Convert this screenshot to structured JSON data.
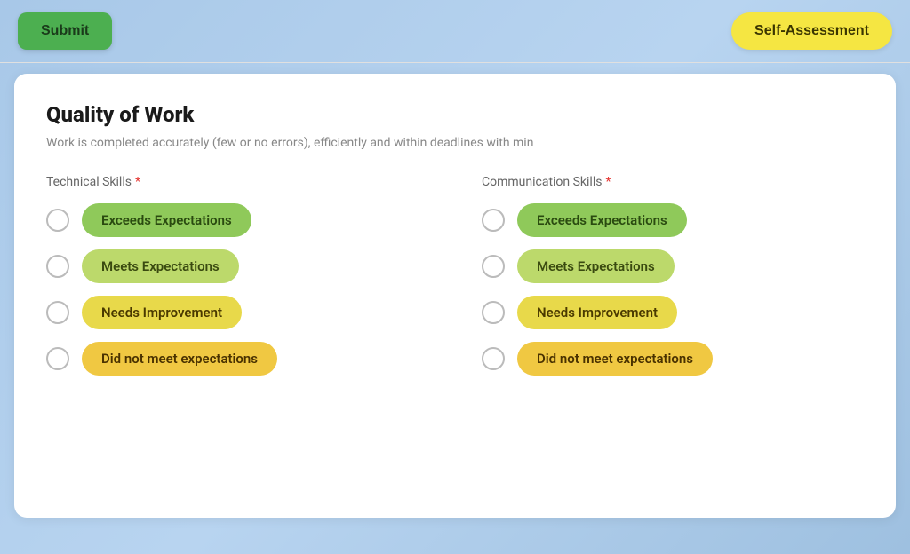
{
  "header": {
    "submit_label": "Submit",
    "badge_label": "Self-Assessment"
  },
  "section": {
    "title": "Quality of Work",
    "description": "Work is completed accurately (few or no errors), efficiently and within deadlines with min"
  },
  "fields": [
    {
      "label": "Technical Skills",
      "required": true,
      "options": [
        {
          "text": "Exceeds Expectations",
          "pill_class": "pill-green"
        },
        {
          "text": "Meets Expectations",
          "pill_class": "pill-yellow-green"
        },
        {
          "text": "Needs Improvement",
          "pill_class": "pill-yellow"
        },
        {
          "text": "Did not meet expectations",
          "pill_class": "pill-orange-yellow"
        }
      ]
    },
    {
      "label": "Communication Skills",
      "required": true,
      "options": [
        {
          "text": "Exceeds Expectations",
          "pill_class": "pill-green"
        },
        {
          "text": "Meets Expectations",
          "pill_class": "pill-yellow-green"
        },
        {
          "text": "Needs Improvement",
          "pill_class": "pill-yellow"
        },
        {
          "text": "Did not meet expectations",
          "pill_class": "pill-orange-yellow"
        }
      ]
    }
  ],
  "required_symbol": "*",
  "pill_classes": {
    "Exceeds Expectations": "pill-green",
    "Meets Expectations": "pill-yellow-green",
    "Needs Improvement": "pill-yellow",
    "Did not meet expectations": "pill-orange-yellow"
  }
}
